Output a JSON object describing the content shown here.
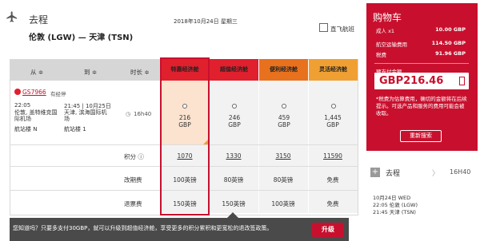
{
  "header": {
    "leg_title": "去程",
    "route": "伦敦 (LGW) — 天津 (TSN)",
    "date": "2018年10月24日 星期三",
    "direct_only_label": "直飞航班"
  },
  "table": {
    "columns": {
      "from": "从 ≑",
      "to": "到 ≑",
      "duration": "时长 ≑"
    },
    "fares": [
      {
        "name": "特惠经济舱",
        "color": "#e0202d",
        "bg": "#f4f4f4",
        "price": "216",
        "currency": "GBP"
      },
      {
        "name": "超值经济舱",
        "color": "#e0202d",
        "bg": "#f4f4f4",
        "price": "246",
        "currency": "GBP"
      },
      {
        "name": "便利经济舱",
        "color": "#e8711e",
        "bg": "#f4f4f4",
        "price": "459",
        "currency": "GBP"
      },
      {
        "name": "灵活经济舱",
        "color": "#f0a033",
        "bg": "#f4f4f4",
        "price": "1,445",
        "currency": "GBP"
      }
    ],
    "flight": {
      "number": "GS7966",
      "stops": "有经停",
      "depart_time": "22:05",
      "depart_place": "伦敦, 盖特维克国际机场",
      "depart_terminal": "航站楼 N",
      "arrive_time": "21:45 | 10月25日",
      "arrive_place": "天津, 滨海国际机场",
      "arrive_terminal": "航站楼 1",
      "duration": "16h40"
    },
    "rows": [
      {
        "label": "积分 ⓘ",
        "values": [
          "1070",
          "1330",
          "3150",
          "11590"
        ]
      },
      {
        "label": "改期费",
        "values": [
          "100英镑",
          "80英镑",
          "80英镑",
          "免费"
        ]
      },
      {
        "label": "退票费",
        "values": [
          "150英镑",
          "150英镑",
          "100英镑",
          "免费"
        ]
      }
    ]
  },
  "banner": {
    "text": "您知道吗？只要多支付30GBP，就可以升级到超值经济舱，享受更多的积分累积和更宽松的退改签政策。",
    "button": "升级"
  },
  "cart": {
    "title": "购物车",
    "lines": [
      {
        "label": "成人 x1",
        "amount": "10.00 GBP"
      },
      {
        "label": "航空运输费用",
        "amount": "114.50 GBP"
      },
      {
        "label": "税费",
        "amount": "91.96 GBP"
      }
    ],
    "total_label": "预支付金额",
    "total_value": "GBP216.46",
    "note": "*税费为估算费用，确切的金额将在后续提示。可选产品和服务的费用可能会被收取。",
    "research_button": "重新搜索"
  },
  "summary": {
    "title": "去程",
    "duration": "16H40",
    "line1": "10月24日 WED",
    "line2": "22:05 伦敦 (LGW)",
    "line3": "21:45 天津 (TSN)"
  }
}
